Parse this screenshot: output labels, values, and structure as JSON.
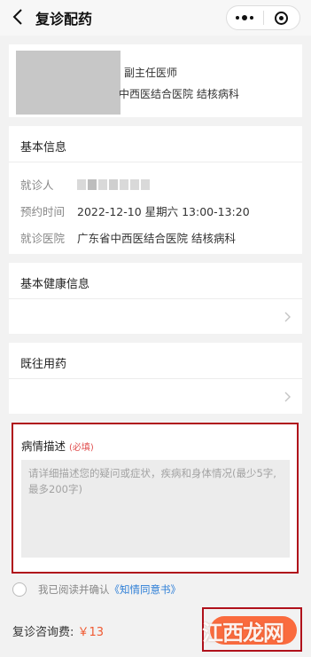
{
  "header": {
    "title": "复诊配药"
  },
  "doctor": {
    "title": "副主任医师",
    "hospital_dept": "中西医结合医院  结核病科"
  },
  "basic_info": {
    "section_title": "基本信息",
    "patient_label": "就诊人",
    "appointment_label": "预约时间",
    "appointment_value": "2022-12-10 星期六 13:00-13:20",
    "hospital_label": "就诊医院",
    "hospital_value": "广东省中西医结合医院  结核病科"
  },
  "health_info": {
    "section_title": "基本健康信息"
  },
  "medication": {
    "section_title": "既往用药"
  },
  "condition": {
    "title": "病情描述",
    "required": "(必填)",
    "placeholder": "请详细描述您的疑问或症状，疾病和身体情况(最少5字,最多200字)"
  },
  "agreement": {
    "prefix": "我已阅读并确认",
    "link": "《知情同意书》"
  },
  "footer": {
    "fee_label": "复诊咨询费:",
    "fee_value": "￥13"
  },
  "watermark": {
    "text": "江西龙网"
  },
  "colors": {
    "accent": "#fa6b3e",
    "price": "#f05a32",
    "highlight_border": "#b0111b",
    "link": "#2e7fd7",
    "required": "#e04e4e"
  }
}
